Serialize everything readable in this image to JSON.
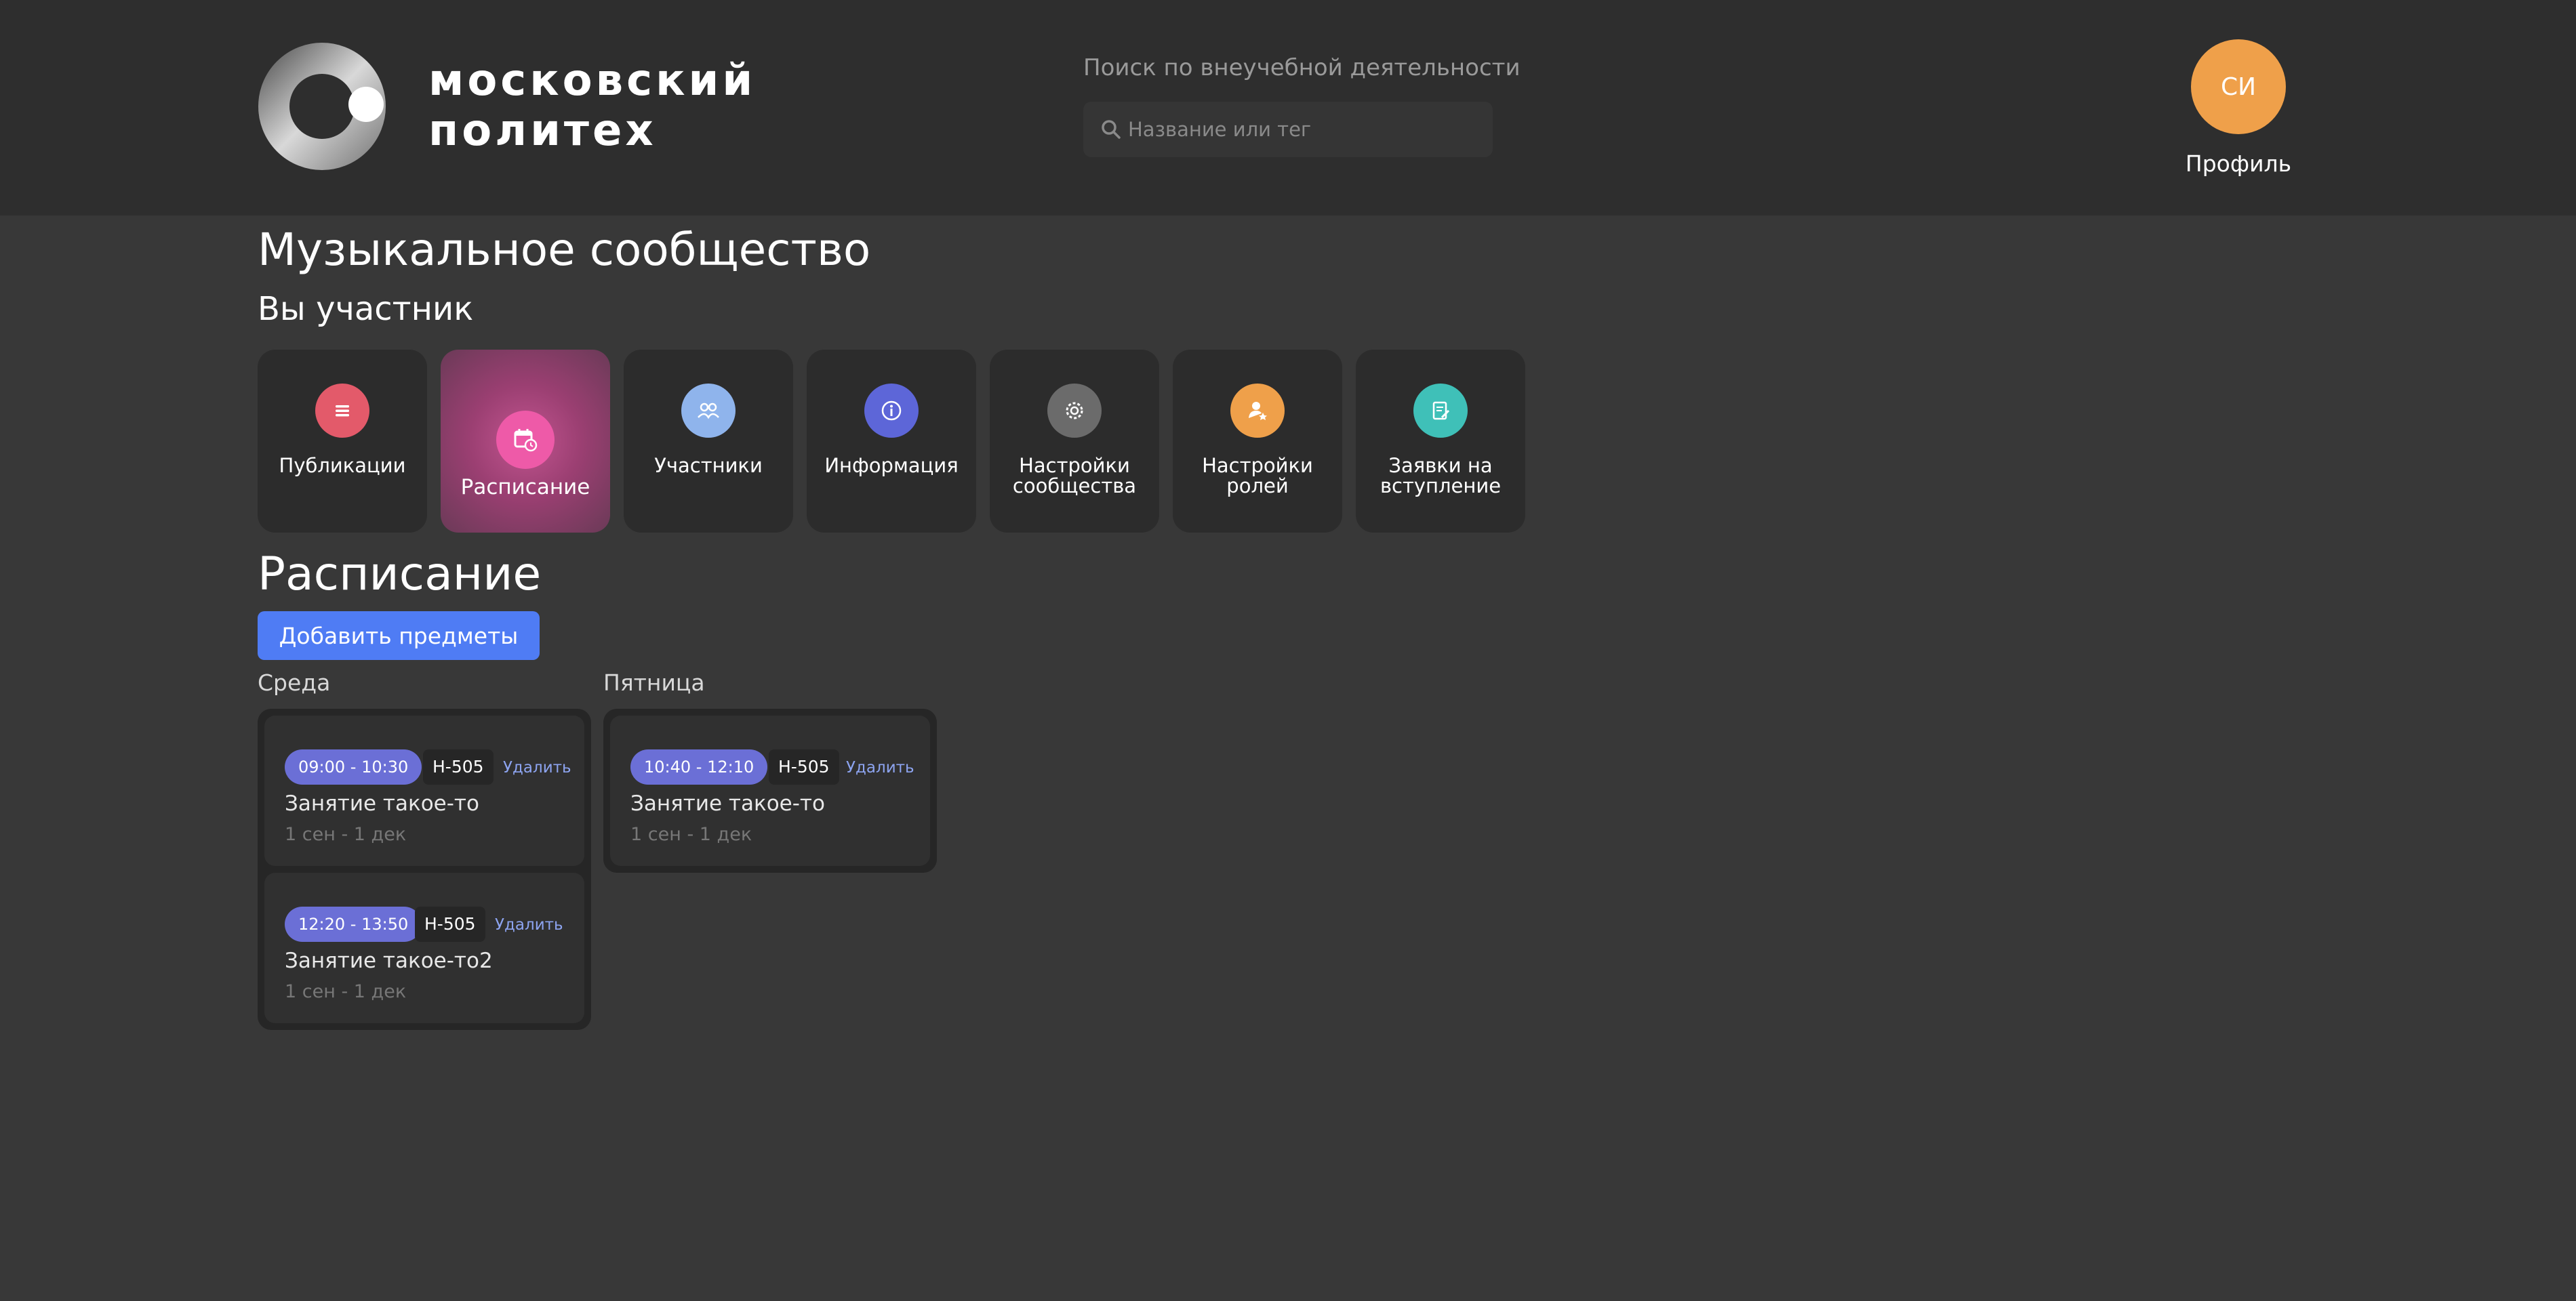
{
  "header": {
    "logo_line1": "московский",
    "logo_line2": "политех",
    "search_title": "Поиск по внеучебной деятельности",
    "search_placeholder": "Название или тег",
    "avatar_initials": "СИ",
    "profile_label": "Профиль"
  },
  "community": {
    "title": "Музыкальное сообщество",
    "member_status": "Вы участник"
  },
  "tiles": [
    {
      "label": "Публикации",
      "icon": "list-icon",
      "color": "#e35a6a",
      "active": false
    },
    {
      "label": "Расписание",
      "icon": "calendar-clock-icon",
      "color": "#ee5aa8",
      "active": true
    },
    {
      "label": "Участники",
      "icon": "users-icon",
      "color": "#8fb4ec",
      "active": false
    },
    {
      "label": "Информация",
      "icon": "info-icon",
      "color": "#5d66d8",
      "active": false
    },
    {
      "label": "Настройки сообщества",
      "icon": "gear-icon",
      "color": "#6b6b6b",
      "active": false
    },
    {
      "label": "Настройки ролей",
      "icon": "user-star-icon",
      "color": "#efa04a",
      "active": false
    },
    {
      "label": "Заявки на вступление",
      "icon": "document-edit-icon",
      "color": "#3fc0b8",
      "active": false
    }
  ],
  "schedule": {
    "title": "Расписание",
    "add_button": "Добавить предметы",
    "days": [
      {
        "name": "Среда",
        "lessons": [
          {
            "time": "09:00 - 10:30",
            "room": "Н-505",
            "delete": "Удалить",
            "name": "Занятие такое-то",
            "dates": "1 сен - 1 дек"
          },
          {
            "time": "12:20 - 13:50",
            "room": "Н-505",
            "delete": "Удалить",
            "name": "Занятие такое-то2",
            "dates": "1 сен - 1 дек"
          }
        ]
      },
      {
        "name": "Пятница",
        "lessons": [
          {
            "time": "10:40 - 12:10",
            "room": "Н-505",
            "delete": "Удалить",
            "name": "Занятие такое-то",
            "dates": "1 сен - 1 дек"
          }
        ]
      }
    ]
  },
  "colors": {
    "accent": "#4f7cf4",
    "avatar": "#efa04a",
    "time_pill": "#6b6fd6",
    "active_tile": "#b04f85"
  }
}
